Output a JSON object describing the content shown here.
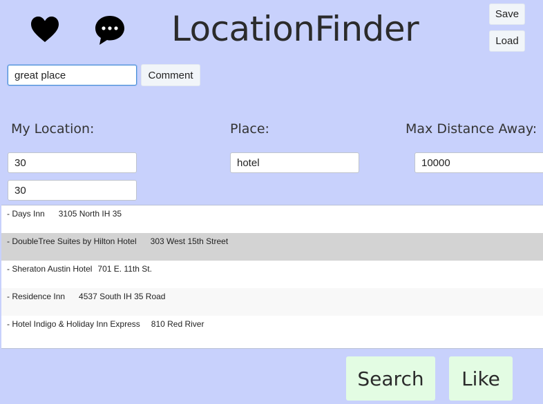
{
  "app": {
    "title": "LocationFinder",
    "background_color": "#c8d1fc"
  },
  "header": {
    "like_icon": "heart-icon",
    "comment_icon": "comment-bubble-icon",
    "save_label": "Save",
    "load_label": "Load"
  },
  "comment": {
    "value": "great place",
    "button_label": "Comment"
  },
  "form": {
    "location_label": "My Location:",
    "latitude_value": "30",
    "longitude_value": "30",
    "place_label": "Place:",
    "place_value": "hotel",
    "distance_label": "Max Distance Away:",
    "distance_value": "10000"
  },
  "results": [
    {
      "name": "- Days Inn",
      "address": "3105 North IH 35",
      "selected": false
    },
    {
      "name": "- DoubleTree Suites by Hilton Hotel",
      "address": "303 West 15th Street",
      "selected": true
    },
    {
      "name": "- Sheraton Austin Hotel",
      "address": "701 E. 11th St.",
      "selected": false
    },
    {
      "name": "- Residence Inn",
      "address": "4537 South IH 35 Road",
      "selected": false
    },
    {
      "name": "- Hotel Indigo & Holiday Inn Express",
      "address": "810 Red River",
      "selected": false
    }
  ],
  "actions": {
    "search_label": "Search",
    "like_label": "Like",
    "button_color": "#e3fce3"
  }
}
